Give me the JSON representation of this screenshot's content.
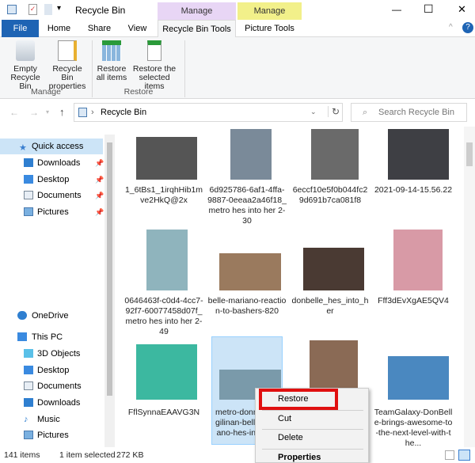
{
  "window": {
    "title": "Recycle Bin",
    "minimize": "—",
    "maximize": "☐",
    "close": "✕"
  },
  "context_tabs": [
    {
      "group": "Manage",
      "label": "Recycle Bin Tools",
      "color": "#e8d6f5"
    },
    {
      "group": "Manage",
      "label": "Picture Tools",
      "color": "#f2f08a"
    }
  ],
  "tabs": [
    "File",
    "Home",
    "Share",
    "View"
  ],
  "ribbon": {
    "buttons": [
      {
        "label1": "Empty",
        "label2": "Recycle Bin"
      },
      {
        "label1": "Recycle Bin",
        "label2": "properties"
      },
      {
        "label1": "Restore",
        "label2": "all items"
      },
      {
        "label1": "Restore the",
        "label2": "selected items"
      }
    ],
    "groups": [
      "Manage",
      "Restore"
    ]
  },
  "address": {
    "path": "Recycle Bin",
    "search_placeholder": "Search Recycle Bin"
  },
  "nav": {
    "items": [
      "Quick access",
      "Downloads",
      "Desktop",
      "Documents",
      "Pictures",
      "OneDrive",
      "This PC",
      "3D Objects",
      "Desktop",
      "Documents",
      "Downloads",
      "Music",
      "Pictures"
    ]
  },
  "files": [
    {
      "name": "1_6tBs1_1irqhHib1mve2HkQ@2x",
      "color": "#555"
    },
    {
      "name": "6d925786-6af1-4ffa-9887-0eeaa2a46f18_metro hes into her 2-30",
      "color": "#7a8a99"
    },
    {
      "name": "6eccf10e5f0b044fc29d691b7ca081f8",
      "color": "#6a6a6a"
    },
    {
      "name": "2021-09-14-15.56.22",
      "color": "#3e3f44"
    },
    {
      "name": "0646463f-c0d4-4cc7-92f7-60077458d07f_metro hes into her 2-49",
      "color": "#8fb4bd"
    },
    {
      "name": "belle-mariano-reaction-to-bashers-820",
      "color": "#9a7a5e"
    },
    {
      "name": "donbelle_hes_into_her",
      "color": "#4a3a33"
    },
    {
      "name": "Fff3dEvXgAE5QV4",
      "color": "#d89aa6"
    },
    {
      "name": "FflSynnaEAAVG3N",
      "color": "#3cb8a0"
    },
    {
      "name": "metro-donny-pangilinan-belle-mariano-hes-into-her",
      "color": "#7a9aaa"
    },
    {
      "name": "",
      "color": "#8a6a55"
    },
    {
      "name": "TeamGalaxy-DonBelle-brings-awesome-to-the-next-level-with-the...",
      "color": "#4a88c0"
    }
  ],
  "context_menu": [
    "Restore",
    "Cut",
    "Delete",
    "Properties"
  ],
  "status": {
    "count": "141 items",
    "selected": "1 item selected",
    "size": "272 KB"
  }
}
